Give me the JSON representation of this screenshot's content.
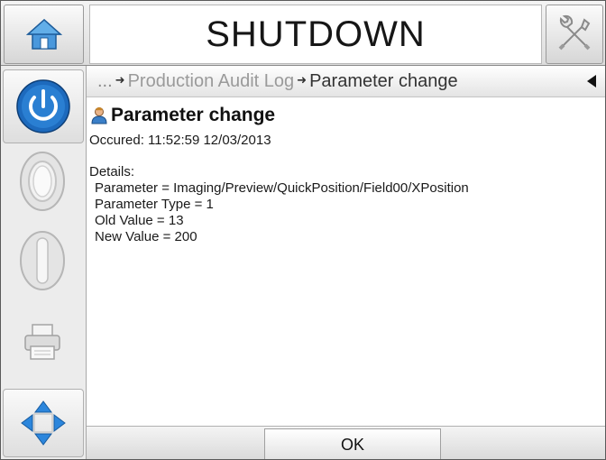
{
  "header": {
    "title": "SHUTDOWN",
    "home_icon": "home-icon",
    "tools_icon": "tools-icon"
  },
  "sidebar": {
    "items": [
      {
        "name": "power-button",
        "icon": "power-icon"
      },
      {
        "name": "start-button",
        "icon": "oval-ring-icon"
      },
      {
        "name": "stop-button",
        "icon": "oval-bar-icon"
      },
      {
        "name": "print-button",
        "icon": "printer-icon"
      },
      {
        "name": "navigate-button",
        "icon": "move-arrows-icon"
      }
    ]
  },
  "breadcrumb": {
    "ellipsis": "...",
    "parent": "Production Audit Log",
    "current": "Parameter change"
  },
  "content": {
    "heading": "Parameter change",
    "occured": "Occured: 11:52:59 12/03/2013",
    "details_label": "Details:",
    "details": [
      "Parameter = Imaging/Preview/QuickPosition/Field00/XPosition",
      "Parameter Type = 1",
      "Old Value = 13",
      "New Value = 200"
    ]
  },
  "footer": {
    "ok_label": "OK"
  },
  "colors": {
    "power_blue": "#1f6fc0",
    "nav_blue": "#2c7fd6",
    "home_blue": "#3a8fd8"
  }
}
